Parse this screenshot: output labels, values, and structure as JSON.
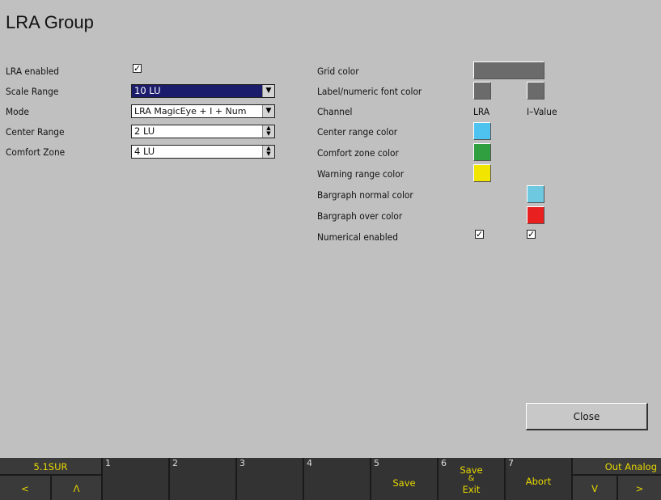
{
  "title": "LRA Group",
  "left_panel": {
    "lra_enabled_label": "LRA enabled",
    "lra_enabled_check": "✓",
    "scale_range_label": "Scale Range",
    "scale_range_value": "10 LU",
    "mode_label": "Mode",
    "mode_value": "LRA MagicEye + I + Num",
    "center_range_label": "Center Range",
    "center_range_value": "2 LU",
    "comfort_zone_label": "Comfort Zone",
    "comfort_zone_value": "4 LU"
  },
  "right_panel": {
    "grid_color_label": "Grid color",
    "label_font_color_label": "Label/numeric font color",
    "channel_label": "Channel",
    "channel_lra": "LRA",
    "channel_ivalue": "I–Value",
    "center_range_color_label": "Center range color",
    "comfort_zone_color_label": "Comfort zone color",
    "warning_range_color_label": "Warning range color",
    "bargraph_normal_label": "Bargraph normal color",
    "bargraph_over_label": "Bargraph over color",
    "numerical_enabled_label": "Numerical enabled",
    "numerical_lra_check": "✓",
    "numerical_ivalue_check": "✓"
  },
  "colors": {
    "grid": "#6b6b6b",
    "label_font_lra": "#6b6b6b",
    "label_font_ivalue": "#6b6b6b",
    "center_range": "#4fc3f0",
    "comfort_zone": "#2f9f3f",
    "warning_range": "#f2e600",
    "bargraph_normal": "#6ec8e0",
    "bargraph_over": "#e82020"
  },
  "close_label": "Close",
  "function_bar": {
    "f0_top": "5.1SUR",
    "f0_left": "<",
    "f0_right": "Λ",
    "f1_num": "1",
    "f2_num": "2",
    "f3_num": "3",
    "f4_num": "4",
    "f5_num": "5",
    "f5_label": "Save",
    "f6_num": "6",
    "f6_label_1": "Save",
    "f6_label_2": "&",
    "f6_label_3": "Exit",
    "f7_num": "7",
    "f7_label": "Abort",
    "f8_top": "Out Analog",
    "f8_left": "V",
    "f8_right": ">"
  }
}
